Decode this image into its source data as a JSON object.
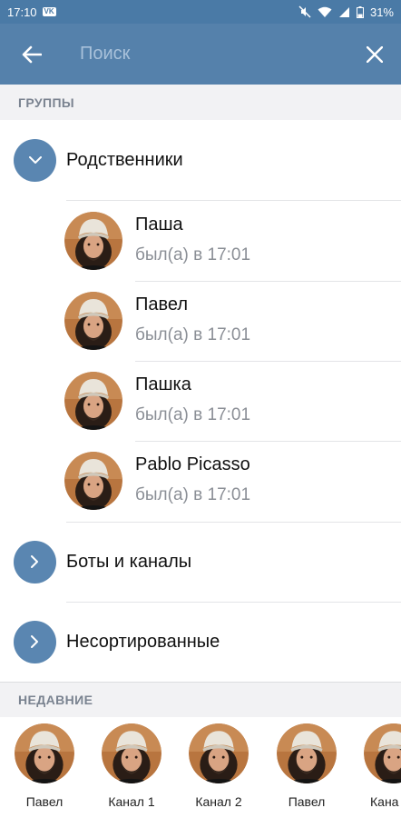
{
  "status_bar": {
    "time": "17:10",
    "badge": "VK",
    "battery": "31%"
  },
  "search": {
    "placeholder": "Поиск",
    "value": ""
  },
  "sections": {
    "groups": "ГРУППЫ",
    "recent": "НЕДАВНИЕ"
  },
  "groups": [
    {
      "title": "Родственники",
      "expanded": true
    },
    {
      "title": "Боты и каналы",
      "expanded": false
    },
    {
      "title": "Несортированные",
      "expanded": false
    }
  ],
  "contacts": [
    {
      "name": "Паша",
      "status": "был(а) в 17:01"
    },
    {
      "name": "Павел",
      "status": "был(а) в 17:01"
    },
    {
      "name": "Пашка",
      "status": "был(а) в 17:01"
    },
    {
      "name": "Pablo Picasso",
      "status": "был(а) в 17:01"
    }
  ],
  "recent": [
    "Павел",
    "Канал 1",
    "Канал 2",
    "Павел",
    "Кана"
  ],
  "colors": {
    "app_bar": "#5581ab",
    "status_bar": "#4a7aa6",
    "group_icon": "#5a86b1",
    "section_bg": "#f2f2f4"
  },
  "icons": {
    "back": "arrow-left-icon",
    "close": "close-icon",
    "expanded": "chevron-down-icon",
    "collapsed": "chevron-right-icon"
  }
}
